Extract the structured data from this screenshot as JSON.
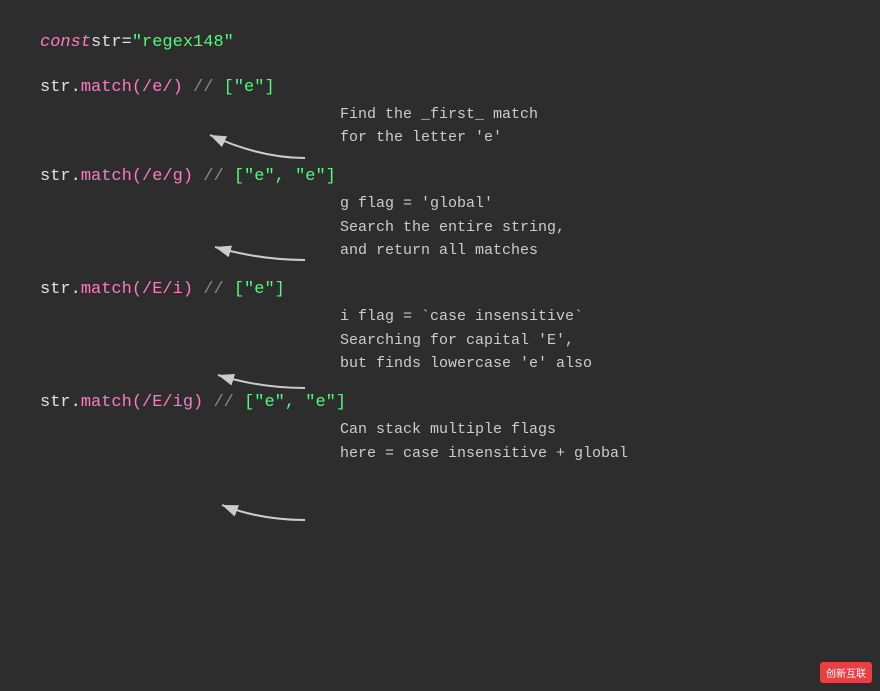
{
  "background": "#2d2d2d",
  "lines": {
    "const_line": {
      "keyword": "const",
      "varName": " str ",
      "operator": "=",
      "stringVal": " \"regex148\""
    },
    "line1": {
      "code": "str.",
      "method": "match",
      "regex": "(/e/)",
      "comment": " // ",
      "result": "[\"e\"]"
    },
    "line1_annotation": "Find the _first_ match\nfor the letter 'e'",
    "line2": {
      "code": "str.",
      "method": "match",
      "regex": "(/e/g)",
      "comment": " // ",
      "result": "[\"e\",  \"e\"]"
    },
    "line2_annotation": "g flag = 'global'\nSearch the entire string,\nand return all matches",
    "line3": {
      "code": "str.",
      "method": "match",
      "regex": "(/E/i)",
      "comment": " // ",
      "result": "[\"e\"]"
    },
    "line3_annotation": "i flag = `case insensitive`\nSearching for capital 'E',\nbut finds lowercase 'e' also",
    "line4": {
      "code": "str.",
      "method": "match",
      "regex": "(/E/ig)",
      "comment": " // ",
      "result": "[\"e\",  \"e\"]"
    },
    "line4_annotation": "Can stack multiple flags\nhere = case insensitive + global"
  },
  "watermark": "创新互联"
}
